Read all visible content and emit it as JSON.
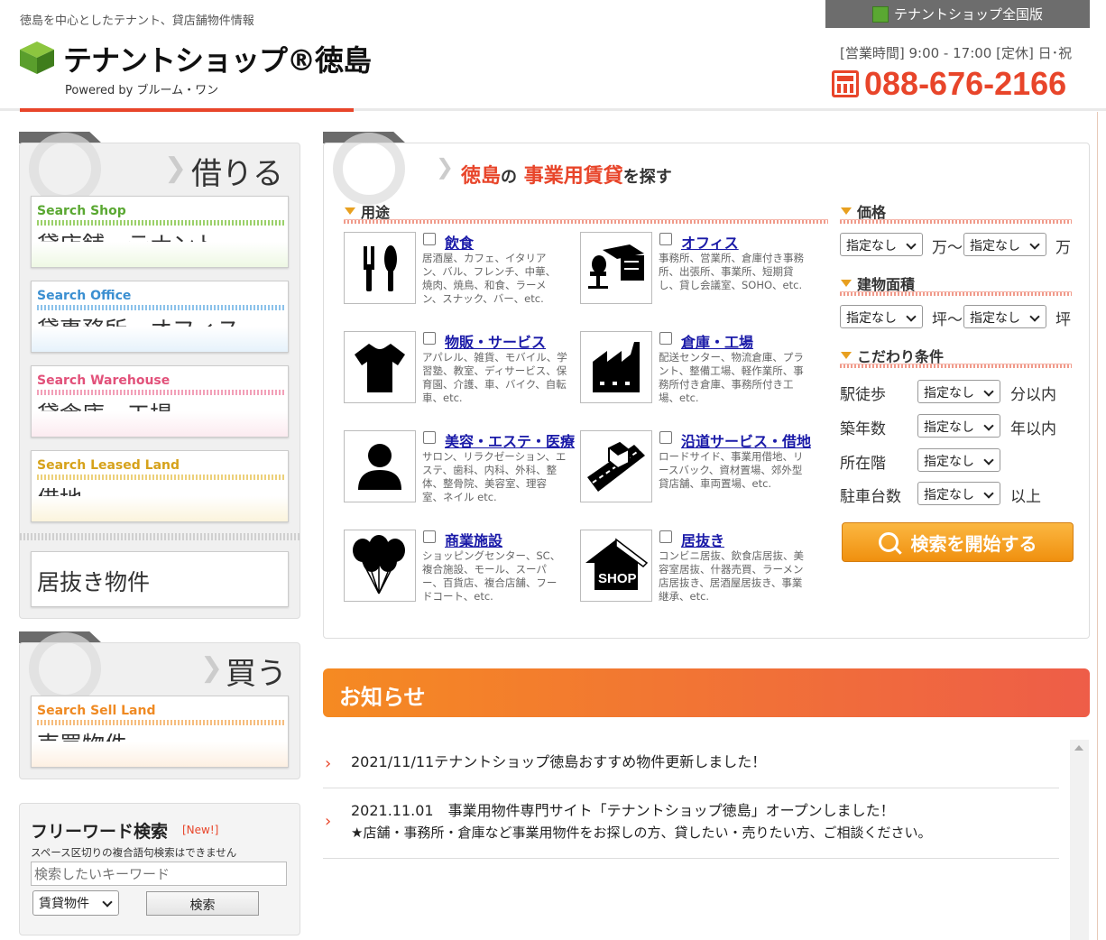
{
  "header": {
    "tagline": "徳島を中心としたテナント、貸店舗物件情報",
    "logo_text": "テナントショップ®徳島",
    "powered": "Powered by ブルーム・ワン",
    "national_link": "テナントショップ全国版",
    "hours": "[営業時間] 9:00 - 17:00 [定休] 日･祝",
    "phone": "088-676-2166"
  },
  "rent": {
    "heading": "借りる",
    "items": [
      {
        "en": "Search Shop",
        "jp": "貸店舗・テナント",
        "color": "#5aa832"
      },
      {
        "en": "Search Office",
        "jp": "貸事務所・オフィス",
        "color": "#3b8fd1"
      },
      {
        "en": "Search Warehouse",
        "jp": "貸倉庫・工場",
        "color": "#e2517a"
      },
      {
        "en": "Search Leased Land",
        "jp": "借地",
        "color": "#d6a21b"
      }
    ],
    "inuki": "居抜き物件"
  },
  "buy": {
    "heading": "買う",
    "item": {
      "en": "Search Sell Land",
      "jp": "売買物件",
      "color": "#ef8a23"
    }
  },
  "freeword": {
    "title": "フリーワード検索",
    "new_badge": "[New!]",
    "note": "スペース区切りの複合語句検索はできません",
    "placeholder": "検索したいキーワード",
    "select": "賃貸物件",
    "button": "検索"
  },
  "search": {
    "title_part1": "徳島",
    "title_part2": "の",
    "title_part3": "事業用賃貸",
    "title_part4": "を探す",
    "usage_heading": "用途",
    "categories": [
      {
        "title": "飲食",
        "desc": "居酒屋、カフェ、イタリアン、バル、フレンチ、中華、焼肉、焼鳥、和食、ラーメン、スナック、バー、etc."
      },
      {
        "title": "オフィス",
        "desc": "事務所、営業所、倉庫付き事務所、出張所、事業所、短期貸し、貸し会議室、SOHO、etc."
      },
      {
        "title": "物販・サービス",
        "desc": "アパレル、雑貨、モバイル、学習塾、教室、ディサービス、保育園、介護、車、バイク、自転車、etc."
      },
      {
        "title": "倉庫・工場",
        "desc": "配送センター、物流倉庫、プラント、整備工場、軽作業所、事務所付き倉庫、事務所付き工場、etc."
      },
      {
        "title": "美容・エステ・医療",
        "desc": "サロン、リラクゼーション、エステ、歯科、内科、外科、整体、整骨院、美容室、理容室、ネイル etc."
      },
      {
        "title": "沿道サービス・借地",
        "desc": "ロードサイド、事業用借地、リースバック、資材置場、郊外型貸店舗、車両置場、etc."
      },
      {
        "title": "商業施設",
        "desc": "ショッピングセンター、SC、複合施設、モール、スーパー、百貨店、複合店舗、フードコート、etc."
      },
      {
        "title": "居抜き",
        "desc": "コンビニ居抜、飲食店居抜、美容室居抜、什器売買、ラーメン店居抜き、居酒屋居抜き、事業継承、etc."
      }
    ],
    "price_heading": "価格",
    "price_from": "指定なし",
    "price_unit1": "万〜",
    "price_to": "指定なし",
    "price_unit2": "万",
    "area_heading": "建物面積",
    "area_from": "指定なし",
    "area_unit1": "坪〜",
    "area_to": "指定なし",
    "area_unit2": "坪",
    "cond_heading": "こだわり条件",
    "conditions": [
      {
        "label": "駅徒歩",
        "value": "指定なし",
        "unit": "分以内"
      },
      {
        "label": "築年数",
        "value": "指定なし",
        "unit": "年以内"
      },
      {
        "label": "所在階",
        "value": "指定なし",
        "unit": ""
      },
      {
        "label": "駐車台数",
        "value": "指定なし",
        "unit": "以上"
      }
    ],
    "button": "検索を開始する",
    "shop_icon_text": "SHOP"
  },
  "news": {
    "heading": "お知らせ",
    "items": [
      {
        "line1": "2021/11/11テナントショップ徳島おすすめ物件更新しました！",
        "line2": ""
      },
      {
        "line1": "2021.11.01　事業用物件専門サイト「テナントショップ徳島」オープンしました！",
        "line2": "★店舗・事務所・倉庫など事業用物件をお探しの方、貸したい・売りたい方、ご相談ください。"
      }
    ]
  }
}
